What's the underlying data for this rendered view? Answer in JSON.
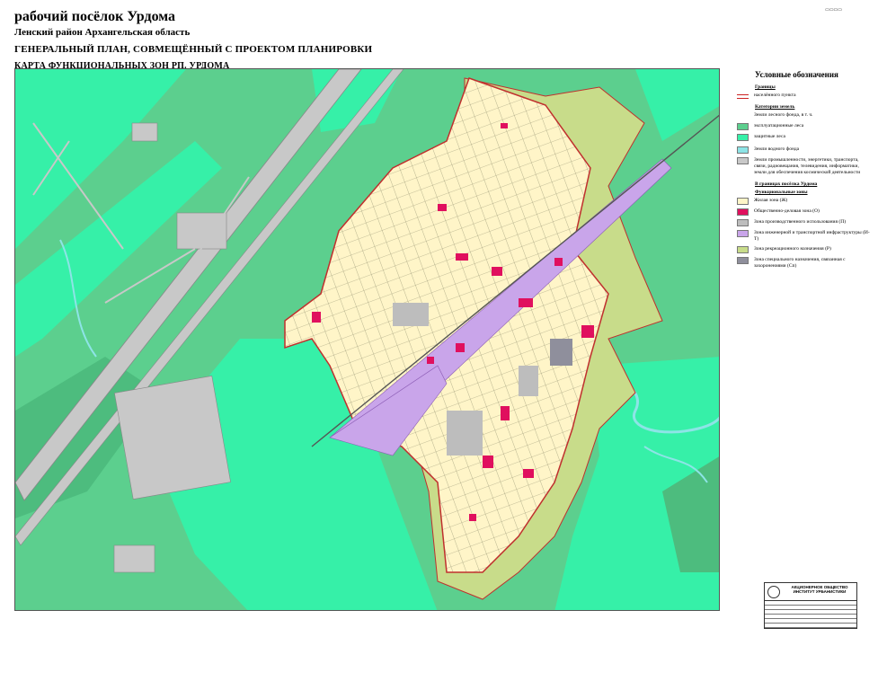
{
  "header": {
    "title": "рабочий посёлок Урдома",
    "district": "Ленский район  Архангельская область",
    "plan": "ГЕНЕРАЛЬНЫЙ ПЛАН, СОВМЕЩЁННЫЙ С ПРОЕКТОМ ПЛАНИРОВКИ",
    "map": "КАРТА ФУНКЦИОНАЛЬНЫХ ЗОН РП. УРДОМА"
  },
  "legend": {
    "title": "Условные обозначения",
    "borders_heading": "Границы",
    "settlement_border": "населённого пункта",
    "land_categories_heading": "Категории земель",
    "forest_fund": "Земли лесного фонда, в т. ч.",
    "operational_forests": "эксплуатационные леса",
    "protective_forests": "защитные леса",
    "water_fund": "Земли водного фонда",
    "industry_lands": "Земли промышленности, энергетики, транспорта, связи, радиовещания, телевидения, информатики, земли для обеспечения космической деятельности",
    "within_borders_heading": "В границах посёлка Урдома",
    "functional_zones_heading": "Функциональные зоны",
    "zones": [
      {
        "label": "Жилая зона (Ж)",
        "color": "#fff5c8"
      },
      {
        "label": "Общественно-деловая зона (О)",
        "color": "#e0105e"
      },
      {
        "label": "Зона производственного использования (П)",
        "color": "#bdbdbd"
      },
      {
        "label": "Зона инженерной и транспортной инфраструктуры (И-Т)",
        "color": "#c9a5ea"
      },
      {
        "label": "Зона рекреационного назначения (Р)",
        "color": "#c8dc8a"
      },
      {
        "label": "Зона специального назначения, связанная с захоронениями (Сп)",
        "color": "#8f8f9c"
      }
    ]
  },
  "titleblock": {
    "org": "АКЦИОНЕРНОЕ ОБЩЕСТВО ИНСТИТУТ УРБАНИСТИКИ"
  },
  "colors": {
    "forest_operational": "#5ccf8e",
    "forest_protective": "#36f0a8",
    "forest_dark": "#4dbc7e",
    "water": "#8de4e6",
    "industry": "#c8c8c8",
    "residential": "#fff5c8",
    "public": "#e0105e",
    "engineering": "#c9a5ea",
    "recreation": "#c8dc8a",
    "border": "#c0302e"
  }
}
